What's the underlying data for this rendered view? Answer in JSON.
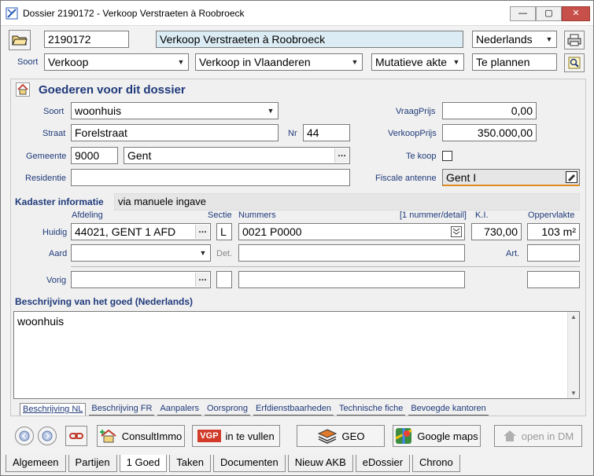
{
  "window": {
    "title": "Dossier 2190172 - Verkoop Verstraeten à Roobroeck",
    "minimize": "—",
    "maximize": "▢",
    "close": "✕"
  },
  "header": {
    "dossier_number": "2190172",
    "dossier_title": "Verkoop Verstraeten à Roobroeck",
    "language": "Nederlands",
    "soort_label": "Soort",
    "soort": "Verkoop",
    "subsoort": "Verkoop in Vlaanderen",
    "akte_type": "Mutatieve akte",
    "status": "Te plannen"
  },
  "goederen": {
    "section_title": "Goederen voor dit dossier",
    "soort_label": "Soort",
    "soort": "woonhuis",
    "straat_label": "Straat",
    "straat": "Forelstraat",
    "nr_label": "Nr",
    "nr": "44",
    "gemeente_label": "Gemeente",
    "postcode": "9000",
    "gemeente": "Gent",
    "residentie_label": "Residentie",
    "residentie": "",
    "vraagprijs_label": "VraagPrijs",
    "vraagprijs": "0,00",
    "verkoopprijs_label": "VerkoopPrijs",
    "verkoopprijs": "350.000,00",
    "tekoop_label": "Te koop",
    "fiscale_label": "Fiscale antenne",
    "fiscale": "Gent I"
  },
  "kadaster": {
    "title": "Kadaster informatie",
    "source": "via manuele ingave",
    "afdeling_header": "Afdeling",
    "sectie_header": "Sectie",
    "nummers_header": "Nummers",
    "nummer_detail": "[1 nummer/detail]",
    "ki_header": "K.I.",
    "oppervlakte_header": "Oppervlakte",
    "huidig_label": "Huidig",
    "afdeling": "44021, GENT  1 AFD",
    "sectie": "L",
    "nummers": "0021 P0000",
    "ki": "730,00",
    "oppervlakte": "103 m²",
    "aard_label": "Aard",
    "det_label": "Det.",
    "art_label": "Art.",
    "vorig_label": "Vorig"
  },
  "beschrijving": {
    "title": "Beschrijving van het goed (Nederlands)",
    "text": "woonhuis"
  },
  "subtabs": [
    "Beschrijving NL",
    "Beschrijving FR",
    "Aanpalers",
    "Oorsprong",
    "Erfdienstbaarheden",
    "Technische fiche",
    "Bevoegde kantoren"
  ],
  "actions": {
    "consultimmo": "ConsultImmo",
    "vgp": "in te vullen",
    "vgp_badge": "VGP",
    "geo": "GEO",
    "googlemaps": "Google maps",
    "openindm": "open in DM"
  },
  "maintabs": [
    "Algemeen",
    "Partijen",
    "1 Goed",
    "Taken",
    "Documenten",
    "Nieuw AKB",
    "eDossier",
    "Chrono"
  ],
  "colors": {
    "accent": "#1f3a7a",
    "title_field": "#dcecf5"
  }
}
